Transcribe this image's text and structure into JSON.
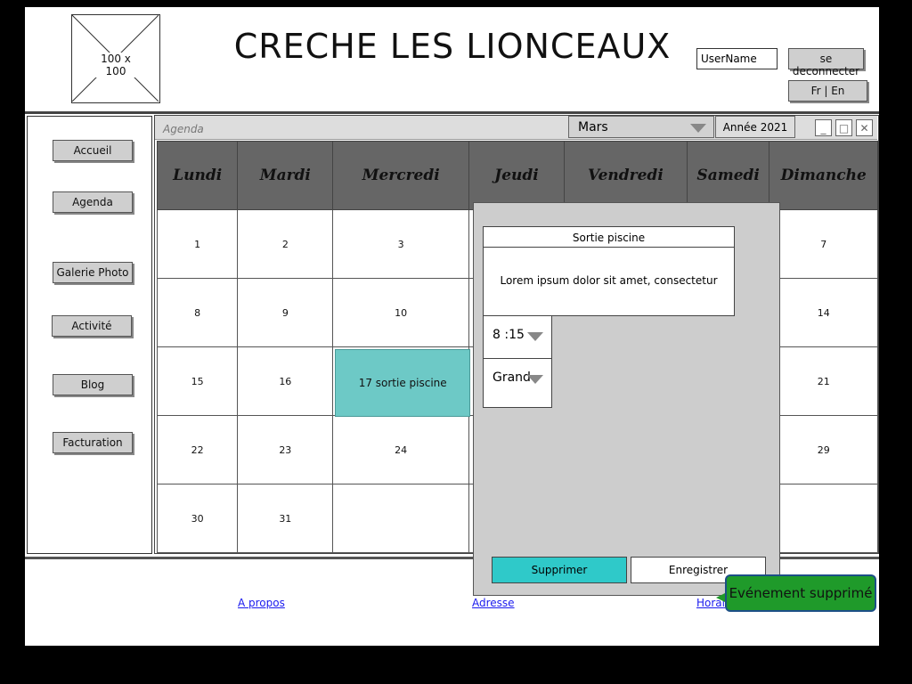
{
  "header": {
    "logo_text": "100 x 100",
    "title": "CRECHE LES LIONCEAUX",
    "username_placeholder": "UserName",
    "logout_label": "se deconnecter",
    "lang_label": "Fr | En"
  },
  "sidebar": {
    "items": [
      {
        "label": "Accueil"
      },
      {
        "label": "Agenda"
      },
      {
        "label": "Galerie Photo"
      },
      {
        "label": "Activité"
      },
      {
        "label": "Blog"
      },
      {
        "label": "Facturation"
      }
    ]
  },
  "agenda": {
    "window_title": "Agenda",
    "month": "Mars",
    "year_label": "Année 2021",
    "days": [
      "Lundi",
      "Mardi",
      "Mercredi",
      "Jeudi",
      "Vendredi",
      "Samedi",
      "Dimanche"
    ],
    "weeks": [
      [
        "1",
        "2",
        "3",
        "",
        "",
        "",
        "7"
      ],
      [
        "8",
        "9",
        "10",
        "",
        "",
        "",
        "14"
      ],
      [
        "15",
        "16",
        "17 sortie piscine",
        "",
        "",
        "",
        "21"
      ],
      [
        "22",
        "23",
        "24",
        "",
        "",
        "",
        "29"
      ],
      [
        "30",
        "31",
        "",
        "",
        "",
        "",
        ""
      ]
    ],
    "event_cell_color": "#6dc9c6"
  },
  "dialog": {
    "title": "Sortie piscine",
    "description": "Lorem ipsum dolor sit amet, consectetur",
    "time_value": "8 :15",
    "group_value": "Grand",
    "delete_label": "Supprimer",
    "save_label": "Enregistrer"
  },
  "toast": {
    "message": "Evénement  supprimé",
    "color": "#1f9a2a"
  },
  "footer": {
    "links": [
      {
        "label": "A propos"
      },
      {
        "label": "Adresse"
      },
      {
        "label": "Horai"
      }
    ]
  }
}
